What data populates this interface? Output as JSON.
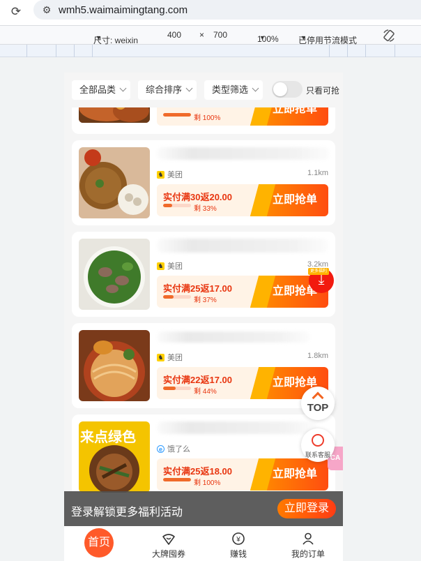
{
  "browser": {
    "url": "wmh5.waimaimingtang.com"
  },
  "devtools": {
    "size_label": "尺寸: weixin",
    "width": "400",
    "times": "×",
    "height": "700",
    "zoom": "100%",
    "throttle": "已停用节流模式"
  },
  "filters": {
    "category": "全部品类",
    "sort": "综合排序",
    "type": "类型筛选",
    "only_available": "只看可抢",
    "only_available_on": false
  },
  "cards": [
    {
      "name": "",
      "platform": "",
      "distance": "",
      "deal": "",
      "remain": "剩 100%",
      "progress": 1.0,
      "grab": "立即抢单"
    },
    {
      "name": "",
      "platform": "美团",
      "distance": "1.1km",
      "deal": "实付满30返20.00",
      "remain": "剩 33%",
      "progress": 0.33,
      "grab": "立即抢单"
    },
    {
      "name": "",
      "platform": "美团",
      "distance": "3.2km",
      "deal": "实付满25返17.00",
      "remain": "剩 37%",
      "progress": 0.37,
      "grab": "立即抢单"
    },
    {
      "name": "",
      "platform": "美团",
      "distance": "1.8km",
      "deal": "实付满22返17.00",
      "remain": "剩 44%",
      "progress": 0.44,
      "grab": "立即抢单"
    },
    {
      "name": "",
      "platform": "饿了么",
      "distance": "",
      "deal": "实付满25返18.00",
      "remain": "剩 100%",
      "progress": 1.0,
      "grab": "立即抢单",
      "thumb_text": "来点绿色"
    }
  ],
  "floating": {
    "top_label": "TOP",
    "service_label": "联系客服",
    "download_badge": "更多福利",
    "side_tag": "CA"
  },
  "login_banner": {
    "text": "登录解锁更多福利活动",
    "button": "立即登录"
  },
  "nav": {
    "home": "首页",
    "coupons": "大牌囤券",
    "earn": "赚钱",
    "orders": "我的订单"
  },
  "colors": {
    "accent": "#ff5a2a",
    "deal_red": "#e8350f",
    "deal_bg": "#fff3e6"
  }
}
